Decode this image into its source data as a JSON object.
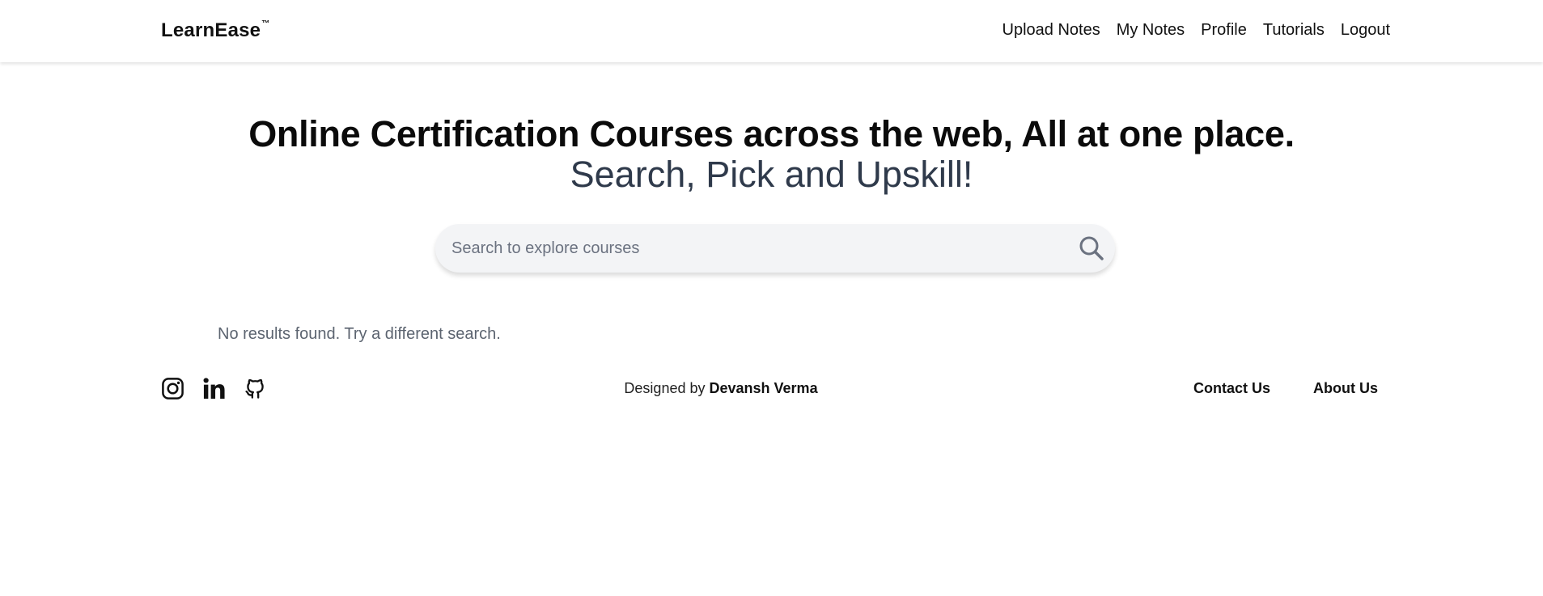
{
  "brand": {
    "name": "LearnEase",
    "trademark": "™"
  },
  "nav": {
    "items": [
      {
        "label": "Upload Notes"
      },
      {
        "label": "My Notes"
      },
      {
        "label": "Profile"
      },
      {
        "label": "Tutorials"
      },
      {
        "label": "Logout"
      }
    ]
  },
  "hero": {
    "title": "Online Certification Courses across the web, All at one place.",
    "subtitle": "Search, Pick and Upskill!"
  },
  "search": {
    "placeholder": "Search to explore courses",
    "value": "",
    "icon": "search-icon"
  },
  "results": {
    "empty_message": "No results found. Try a different search."
  },
  "footer": {
    "socials": [
      {
        "icon": "instagram-icon"
      },
      {
        "icon": "linkedin-icon"
      },
      {
        "icon": "github-icon"
      }
    ],
    "designed_prefix": "Designed by ",
    "designer": "Devansh Verma",
    "contact_label": "Contact Us",
    "about_label": "About Us"
  },
  "colors": {
    "background": "#ffffff",
    "subtitle": "#2f3a4b",
    "search_bg": "#f3f4f6",
    "muted_text": "#5c6470",
    "search_icon": "#6b7280"
  }
}
